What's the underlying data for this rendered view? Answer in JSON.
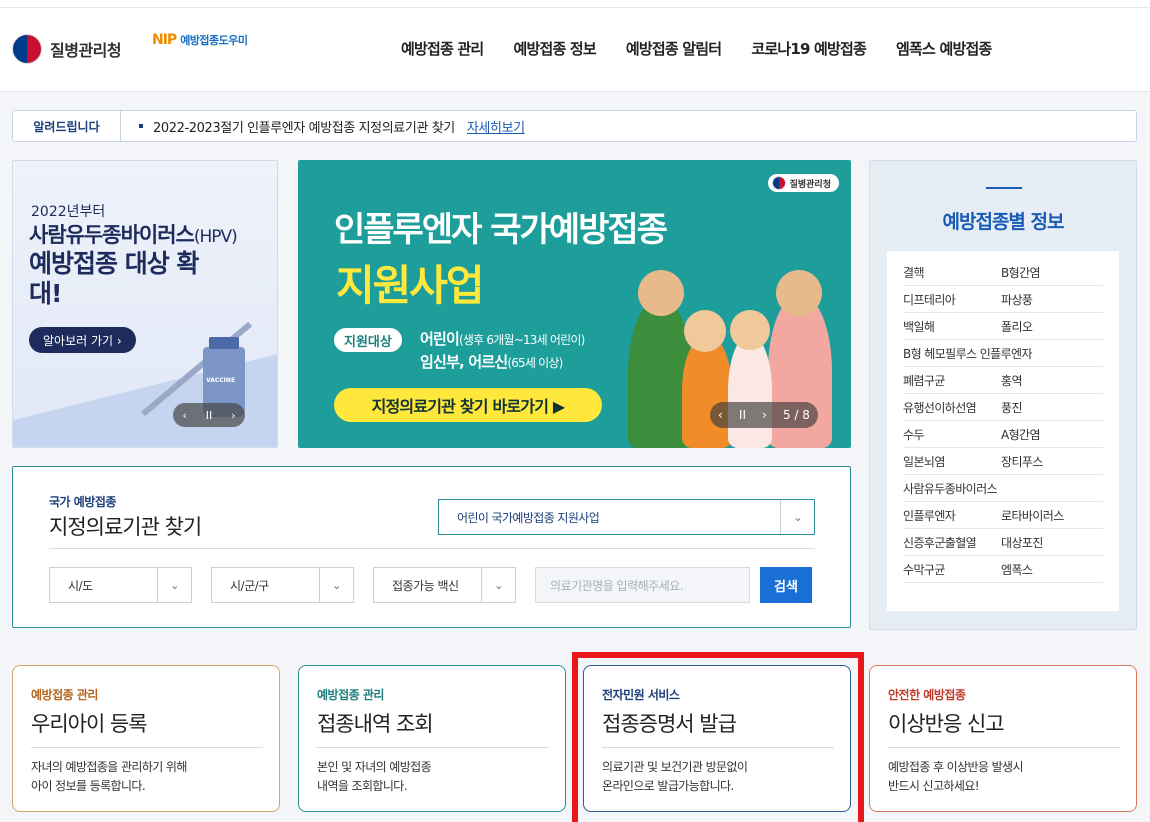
{
  "header": {
    "kdca_logo": "질병관리청",
    "nip_mark": "NIP",
    "nip_logo": "예방접종도우미",
    "nav": [
      "예방접종 관리",
      "예방접종 정보",
      "예방접종 알림터",
      "코로나19 예방접종",
      "엠폭스 예방접종"
    ]
  },
  "notice": {
    "tag": "알려드립니다",
    "message": "2022-2023절기 인플루엔자 예방접종 지정의료기관 찾기",
    "more": "자세히보기"
  },
  "hpv_banner": {
    "line1": "2022년부터",
    "line2": "사람유두종바이러스",
    "line2_suffix": "(HPV)",
    "line3": "예방접종 대상 확대!",
    "button": "알아보러 가기 ›",
    "vaccine_label": "VACCINE",
    "pager_prev": "‹",
    "pager_pause": "II",
    "pager_next": "›"
  },
  "flu_banner": {
    "brand": "질병관리청",
    "title1": "인플루엔자 국가예방접종",
    "title2": "지원사업",
    "chip": "지원대상",
    "target1": "어린이",
    "target1_note": "(생후 6개월~13세 어린이)",
    "target2": "임신부, 어르신",
    "target2_note": "(65세 이상)",
    "cta": "지정의료기관 찾기 바로가기 ▶",
    "pager_prev": "‹",
    "pager_pause": "II",
    "pager_next": "›",
    "pager_count": "5 / 8"
  },
  "info_panel": {
    "title": "예방접종별 정보",
    "items": [
      [
        "결핵",
        "B형간염"
      ],
      [
        "디프테리아",
        "파상풍"
      ],
      [
        "백일해",
        "폴리오"
      ],
      [
        "B형 헤모필루스 인플루엔자",
        ""
      ],
      [
        "폐렴구균",
        "홍역"
      ],
      [
        "유행선이하선염",
        "풍진"
      ],
      [
        "수두",
        "A형간염"
      ],
      [
        "일본뇌염",
        "장티푸스"
      ],
      [
        "사람유두종바이러스",
        ""
      ],
      [
        "인플루엔자",
        "로타바이러스"
      ],
      [
        "신증후군출혈열",
        "대상포진"
      ],
      [
        "수막구균",
        "엠폭스"
      ]
    ]
  },
  "finder": {
    "subtitle": "국가 예방접종",
    "title": "지정의료기관 찾기",
    "program_select": "어린이 국가예방접종 지원사업",
    "sido": "시/도",
    "sigungu": "시/군/구",
    "vaccine": "접종가능 백신",
    "search_placeholder": "의료기관명을 입력해주세요.",
    "search_button": "검색"
  },
  "cards": [
    {
      "category": "예방접종 관리",
      "title": "우리아이 등록",
      "desc1": "자녀의 예방접종을 관리하기 위해",
      "desc2": "아이 정보를 등록합니다.",
      "accent": "#b5651d",
      "border": "#d9a266"
    },
    {
      "category": "예방접종 관리",
      "title": "접종내역 조회",
      "desc1": "본인 및 자녀의 예방접종",
      "desc2": "내역을 조회합니다.",
      "accent": "#1d7f7d",
      "border": "#2c8c96"
    },
    {
      "category": "전자민원 서비스",
      "title": "접종증명서 발급",
      "desc1": "의료기관 및 보건기관 방문없이",
      "desc2": "온라인으로 발급가능합니다.",
      "accent": "#1d3f7a",
      "border": "#2c5c96"
    },
    {
      "category": "안전한 예방접종",
      "title": "이상반응 신고",
      "desc1": "예방접종 후 이상반응 발생시",
      "desc2": "반드시 신고하세요!",
      "accent": "#c0392b",
      "border": "#d97a5a"
    }
  ]
}
